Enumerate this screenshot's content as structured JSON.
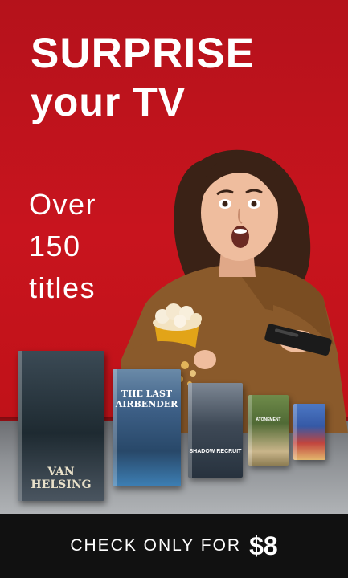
{
  "headline": {
    "line1": "SURPRISE",
    "line2": "your TV"
  },
  "subheadline": {
    "line1": "Over",
    "line2": "150",
    "line3": "titles"
  },
  "movies": [
    {
      "title": "VAN HELSING"
    },
    {
      "title": "THE LAST AIRBENDER"
    },
    {
      "title": "SHADOW RECRUIT"
    },
    {
      "title": "ATONEMENT"
    },
    {
      "title": ""
    }
  ],
  "cta": {
    "text": "CHECK ONLY FOR",
    "price": "$8"
  },
  "colors": {
    "background": "#c8141e",
    "bar": "#111111",
    "text": "#ffffff"
  }
}
